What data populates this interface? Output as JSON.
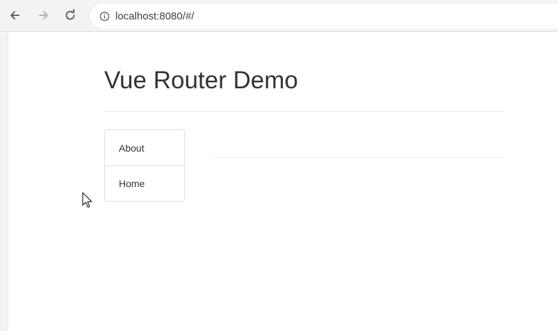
{
  "browser": {
    "url": "localhost:8080/#/",
    "back_icon": "arrow-left",
    "forward_icon": "arrow-right",
    "reload_icon": "reload",
    "info_icon": "info-circle"
  },
  "page": {
    "title": "Vue Router Demo",
    "nav_items": [
      {
        "label": "About"
      },
      {
        "label": "Home"
      }
    ]
  },
  "colors": {
    "text": "#333333",
    "border": "#dddddd",
    "toolbar": "#f1f3f4"
  }
}
